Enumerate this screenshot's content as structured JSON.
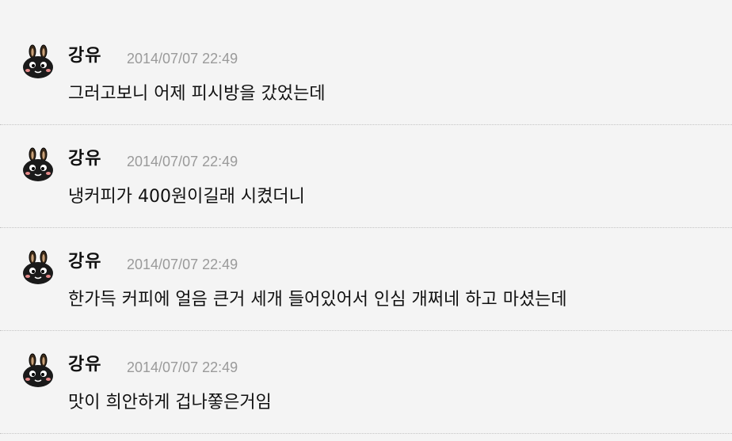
{
  "messages": [
    {
      "author": "강유",
      "timestamp": "2014/07/07 22:49",
      "text": "그러고보니 어제 피시방을 갔었는데",
      "avatar_icon": "bunny-icon"
    },
    {
      "author": "강유",
      "timestamp": "2014/07/07 22:49",
      "text": "냉커피가 400원이길래 시켰더니",
      "avatar_icon": "bunny-icon"
    },
    {
      "author": "강유",
      "timestamp": "2014/07/07 22:49",
      "text": "한가득 커피에 얼음 큰거 세개 들어있어서 인심 개쩌네 하고 마셨는데",
      "avatar_icon": "bunny-icon"
    },
    {
      "author": "강유",
      "timestamp": "2014/07/07 22:49",
      "text": "맛이 희안하게 겁나쫗은거임",
      "avatar_icon": "bunny-icon"
    }
  ],
  "colors": {
    "background": "#f4f4f4",
    "author": "#111111",
    "timestamp": "#9a9a9a",
    "separator": "#c4c4c4"
  }
}
